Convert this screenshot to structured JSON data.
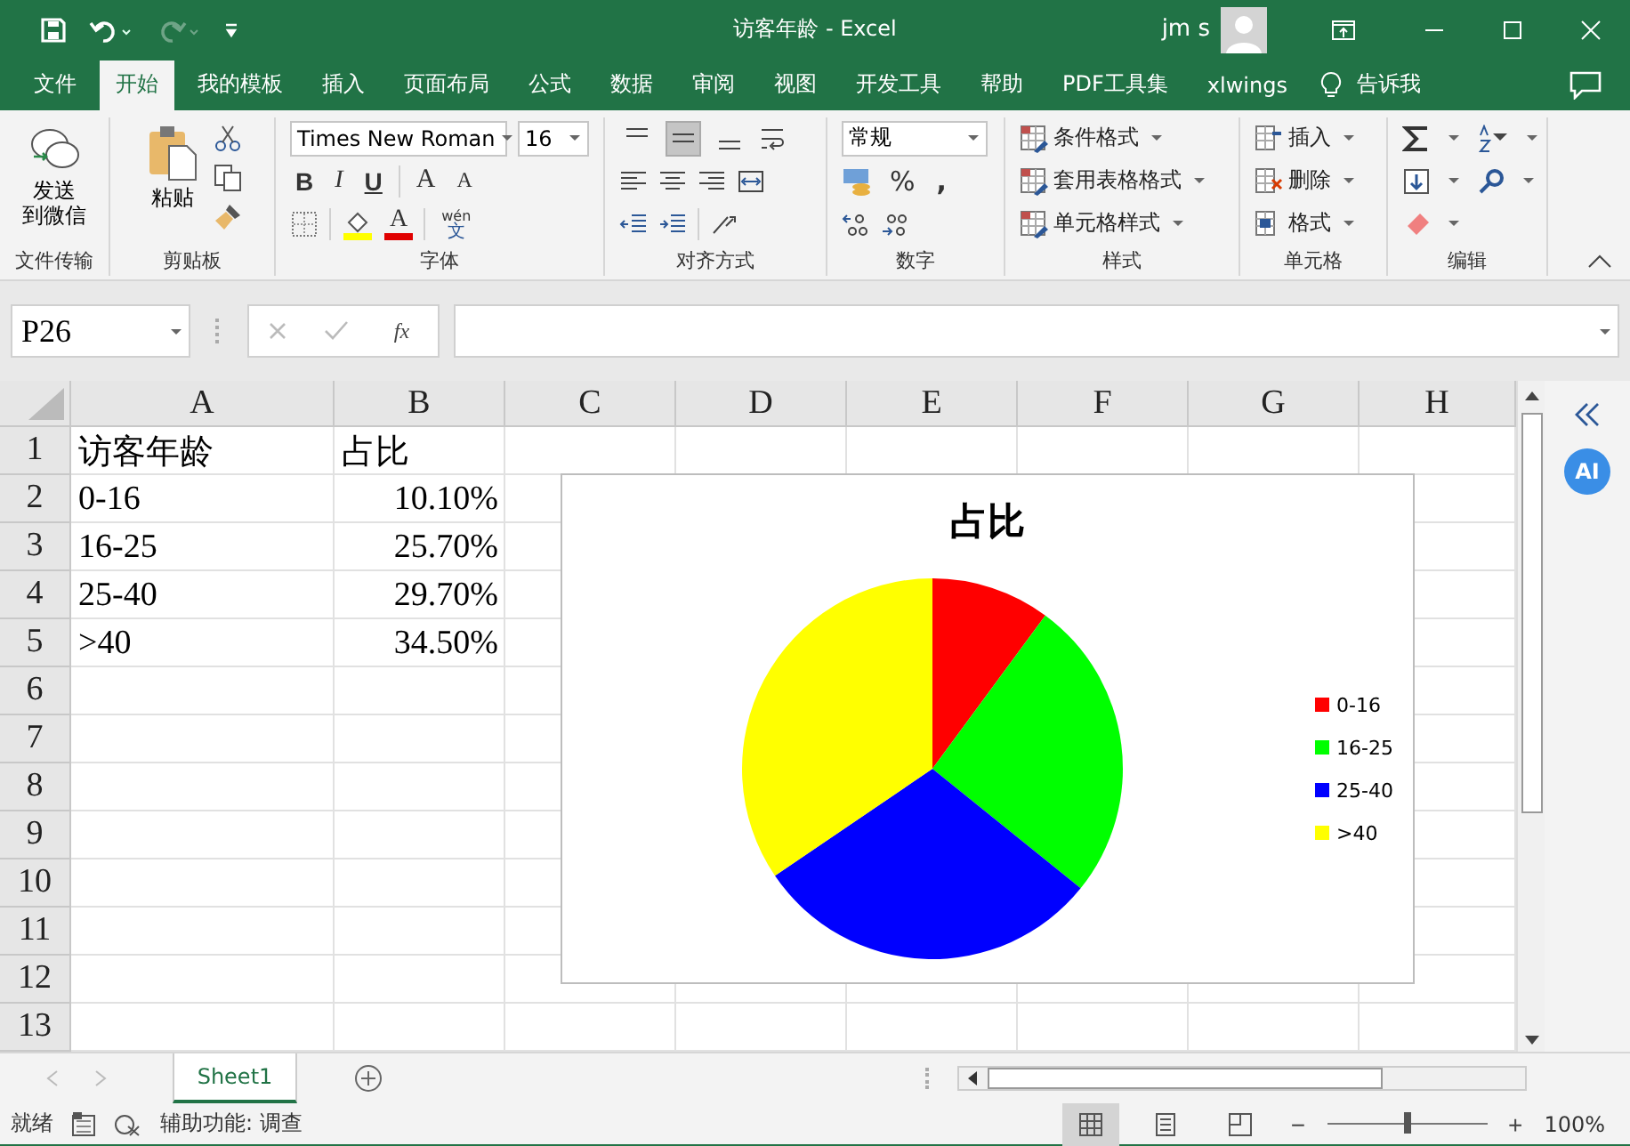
{
  "window": {
    "title": "访客年龄  -  Excel",
    "user": "jm s"
  },
  "menu_tabs": [
    {
      "label": "文件",
      "selected": false
    },
    {
      "label": "开始",
      "selected": true
    },
    {
      "label": "我的模板",
      "selected": false
    },
    {
      "label": "插入",
      "selected": false
    },
    {
      "label": "页面布局",
      "selected": false
    },
    {
      "label": "公式",
      "selected": false
    },
    {
      "label": "数据",
      "selected": false
    },
    {
      "label": "审阅",
      "selected": false
    },
    {
      "label": "视图",
      "selected": false
    },
    {
      "label": "开发工具",
      "selected": false
    },
    {
      "label": "帮助",
      "selected": false
    },
    {
      "label": "PDF工具集",
      "selected": false
    },
    {
      "label": "xlwings",
      "selected": false
    }
  ],
  "tell_me": "告诉我",
  "ribbon": {
    "groups": [
      {
        "label": "文件传输",
        "buttons": [
          {
            "lines": [
              "发送",
              "到微信"
            ]
          }
        ]
      },
      {
        "label": "剪贴板",
        "buttons": [
          {
            "label": "粘贴"
          }
        ]
      },
      {
        "label": "字体",
        "font_name": "Times New Roman",
        "font_size": "16",
        "buttons": [
          {
            "label": "B"
          },
          {
            "label": "I"
          },
          {
            "label": "U"
          },
          {
            "label": "A"
          },
          {
            "label": "A"
          },
          {
            "label": "A"
          }
        ],
        "phonetic": [
          "wén",
          "文"
        ]
      },
      {
        "label": "对齐方式",
        "vertical_align": [
          {
            "selected": false
          },
          {
            "selected": true
          },
          {
            "selected": false
          }
        ]
      },
      {
        "label": "数字",
        "format": "常规",
        "buttons": [
          {
            "label": "%"
          },
          {
            "label": ","
          }
        ]
      },
      {
        "label": "样式",
        "buttons": [
          {
            "label": "条件格式"
          },
          {
            "label": "套用表格格式"
          },
          {
            "label": "单元格样式"
          }
        ]
      },
      {
        "label": "单元格",
        "buttons": [
          {
            "label": "插入"
          },
          {
            "label": "删除"
          },
          {
            "label": "格式"
          }
        ]
      },
      {
        "label": "编辑"
      }
    ]
  },
  "formula_bar": {
    "name_box": "P26",
    "fx": "fx"
  },
  "sheet": {
    "columns": [
      "A",
      "B",
      "C",
      "D",
      "E",
      "F",
      "G",
      "H"
    ],
    "rows": [
      {
        "number": "1",
        "cells": [
          {
            "text": "访客年龄",
            "kind": "text"
          },
          {
            "text": "占比",
            "kind": "text"
          }
        ]
      },
      {
        "number": "2",
        "cells": [
          {
            "text": "0-16",
            "kind": "text"
          },
          {
            "text": "10.10%",
            "kind": "number"
          }
        ]
      },
      {
        "number": "3",
        "cells": [
          {
            "text": "16-25",
            "kind": "text"
          },
          {
            "text": "25.70%",
            "kind": "number"
          }
        ]
      },
      {
        "number": "4",
        "cells": [
          {
            "text": "25-40",
            "kind": "text"
          },
          {
            "text": "29.70%",
            "kind": "number"
          }
        ]
      },
      {
        "number": "5",
        "cells": [
          {
            "text": ">40",
            "kind": "text"
          },
          {
            "text": "34.50%",
            "kind": "number"
          }
        ]
      },
      {
        "number": "6",
        "cells": []
      },
      {
        "number": "7",
        "cells": []
      },
      {
        "number": "8",
        "cells": []
      },
      {
        "number": "9",
        "cells": []
      },
      {
        "number": "10",
        "cells": []
      },
      {
        "number": "11",
        "cells": []
      },
      {
        "number": "12",
        "cells": []
      },
      {
        "number": "13",
        "cells": []
      }
    ]
  },
  "chart": {
    "chart_data": {
      "type": "pie",
      "title": "占比",
      "categories": [
        "0-16",
        "16-25",
        "25-40",
        ">40"
      ],
      "colors": [
        "#ff0000",
        "#00ff00",
        "#0000ff",
        "#ffff00"
      ],
      "legend": "right",
      "series": [
        {
          "values": [
            10.1,
            25.7,
            29.7,
            34.5
          ]
        }
      ]
    }
  },
  "side_pane": {
    "badge": "AI"
  },
  "sheet_tabs": [
    {
      "label": "Sheet1",
      "selected": true
    }
  ],
  "status_bar": {
    "mode": "就绪",
    "accessibility": "辅助功能: 调查",
    "views": [
      {
        "selected": true
      },
      {
        "selected": false
      },
      {
        "selected": false
      }
    ],
    "zoom_out": "−",
    "zoom_in": "+",
    "zoom": {
      "level": 0.5
    },
    "zoom_text": "100%"
  }
}
